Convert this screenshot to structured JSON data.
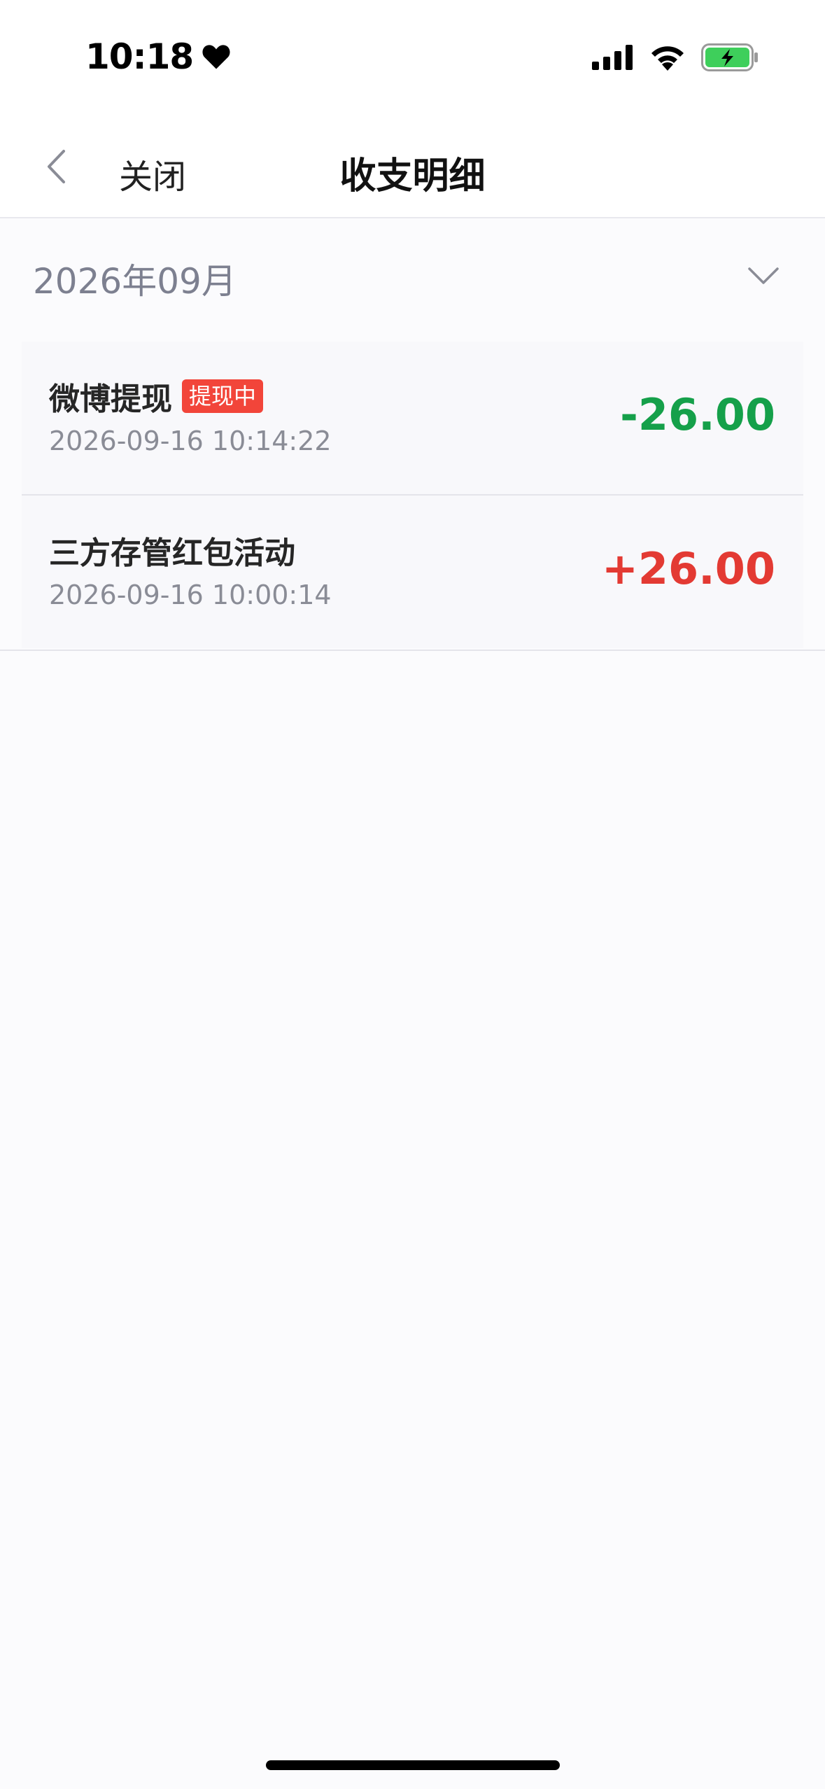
{
  "status_bar": {
    "time": "10:18",
    "icons": [
      "heart-icon",
      "signal-icon",
      "wifi-icon",
      "battery-charging-icon"
    ],
    "battery_color": "#3ecf5b"
  },
  "nav": {
    "back_icon": "chevron-left-icon",
    "close_label": "关闭",
    "title": "收支明细"
  },
  "filter": {
    "month_label": "2026年09月",
    "chevron_icon": "chevron-down-icon"
  },
  "transactions": [
    {
      "title": "微博提现",
      "badge": "提现中",
      "time": "2026-09-16 10:14:22",
      "amount": "-26.00",
      "amount_color": "#15a04a"
    },
    {
      "title": "三方存管红包活动",
      "badge": "",
      "time": "2026-09-16 10:00:14",
      "amount": "+26.00",
      "amount_color": "#e33a33"
    }
  ],
  "colors": {
    "badge_bg": "#f2453a",
    "negative": "#15a04a",
    "positive": "#e33a33"
  }
}
